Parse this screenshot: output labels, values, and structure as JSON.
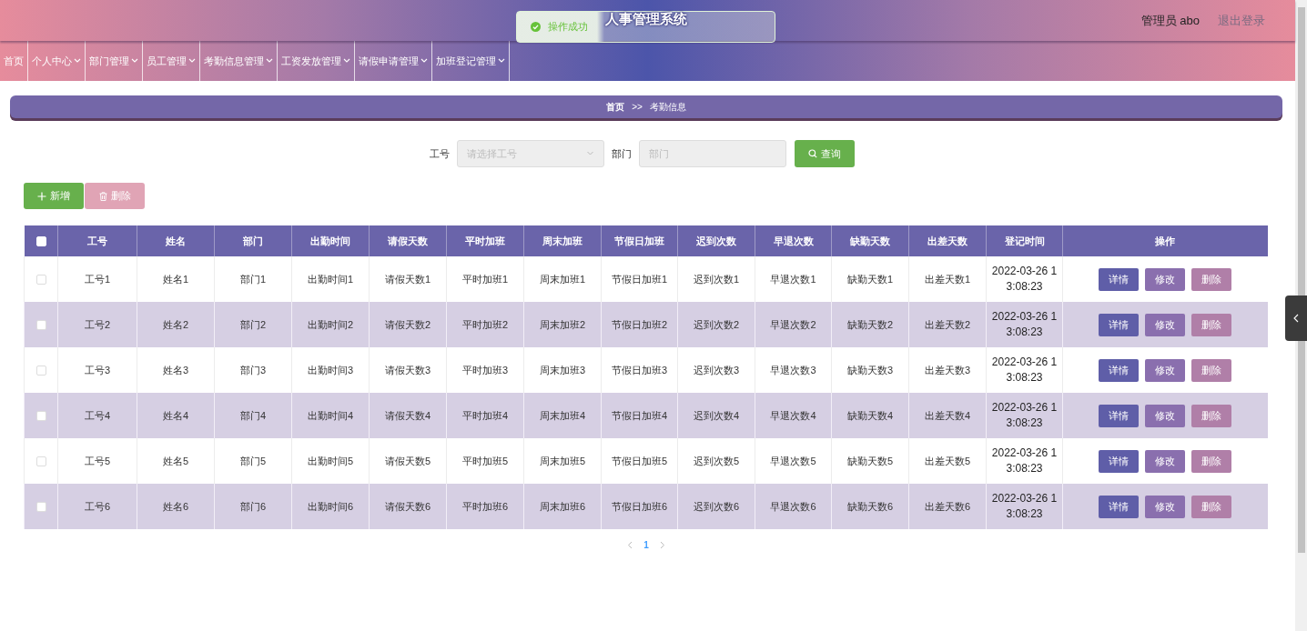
{
  "header": {
    "title": "人事管理系统",
    "user": "管理员 abo",
    "logout": "退出登录"
  },
  "toast": {
    "message": "操作成功"
  },
  "nav": {
    "items": [
      {
        "label": "首页",
        "has_menu": false
      },
      {
        "label": "个人中心",
        "has_menu": true
      },
      {
        "label": "部门管理",
        "has_menu": true
      },
      {
        "label": "员工管理",
        "has_menu": true
      },
      {
        "label": "考勤信息管理",
        "has_menu": true
      },
      {
        "label": "工资发放管理",
        "has_menu": true
      },
      {
        "label": "请假申请管理",
        "has_menu": true
      },
      {
        "label": "加班登记管理",
        "has_menu": true
      }
    ]
  },
  "breadcrumb": {
    "items": [
      "首页",
      "考勤信息"
    ],
    "separator": ">>"
  },
  "search": {
    "fields": [
      {
        "label": "工号",
        "kind": "select",
        "placeholder": "请选择工号"
      },
      {
        "label": "部门",
        "kind": "input",
        "placeholder": "部门"
      }
    ],
    "button": "查询"
  },
  "toolbar": [
    {
      "label": "新增",
      "kind": "add",
      "disabled": false
    },
    {
      "label": "删除",
      "kind": "delete",
      "disabled": true
    }
  ],
  "table": {
    "select_all": {
      "checked": false
    },
    "columns": [
      "工号",
      "姓名",
      "部门",
      "出勤时间",
      "请假天数",
      "平时加班",
      "周末加班",
      "节假日加班",
      "迟到次数",
      "早退次数",
      "缺勤天数",
      "出差天数",
      "登记时间",
      "操作"
    ],
    "rows": [
      {
        "checked": false,
        "cells": [
          "工号1",
          "姓名1",
          "部门1",
          "出勤时间1",
          "请假天数1",
          "平时加班1",
          "周末加班1",
          "节假日加班1",
          "迟到次数1",
          "早退次数1",
          "缺勤天数1",
          "出差天数1",
          "2022-03-26 13:08:23"
        ],
        "actions": [
          {
            "label": "详情",
            "kind": "view"
          },
          {
            "label": "修改",
            "kind": "edit"
          },
          {
            "label": "删除",
            "kind": "delete"
          }
        ]
      },
      {
        "checked": false,
        "cells": [
          "工号2",
          "姓名2",
          "部门2",
          "出勤时间2",
          "请假天数2",
          "平时加班2",
          "周末加班2",
          "节假日加班2",
          "迟到次数2",
          "早退次数2",
          "缺勤天数2",
          "出差天数2",
          "2022-03-26 13:08:23"
        ],
        "actions": [
          {
            "label": "详情",
            "kind": "view"
          },
          {
            "label": "修改",
            "kind": "edit"
          },
          {
            "label": "删除",
            "kind": "delete"
          }
        ]
      },
      {
        "checked": false,
        "cells": [
          "工号3",
          "姓名3",
          "部门3",
          "出勤时间3",
          "请假天数3",
          "平时加班3",
          "周末加班3",
          "节假日加班3",
          "迟到次数3",
          "早退次数3",
          "缺勤天数3",
          "出差天数3",
          "2022-03-26 13:08:23"
        ],
        "actions": [
          {
            "label": "详情",
            "kind": "view"
          },
          {
            "label": "修改",
            "kind": "edit"
          },
          {
            "label": "删除",
            "kind": "delete"
          }
        ]
      },
      {
        "checked": false,
        "cells": [
          "工号4",
          "姓名4",
          "部门4",
          "出勤时间4",
          "请假天数4",
          "平时加班4",
          "周末加班4",
          "节假日加班4",
          "迟到次数4",
          "早退次数4",
          "缺勤天数4",
          "出差天数4",
          "2022-03-26 13:08:23"
        ],
        "actions": [
          {
            "label": "详情",
            "kind": "view"
          },
          {
            "label": "修改",
            "kind": "edit"
          },
          {
            "label": "删除",
            "kind": "delete"
          }
        ]
      },
      {
        "checked": false,
        "cells": [
          "工号5",
          "姓名5",
          "部门5",
          "出勤时间5",
          "请假天数5",
          "平时加班5",
          "周末加班5",
          "节假日加班5",
          "迟到次数5",
          "早退次数5",
          "缺勤天数5",
          "出差天数5",
          "2022-03-26 13:08:23"
        ],
        "actions": [
          {
            "label": "详情",
            "kind": "view"
          },
          {
            "label": "修改",
            "kind": "edit"
          },
          {
            "label": "删除",
            "kind": "delete"
          }
        ]
      },
      {
        "checked": false,
        "cells": [
          "工号6",
          "姓名6",
          "部门6",
          "出勤时间6",
          "请假天数6",
          "平时加班6",
          "周末加班6",
          "节假日加班6",
          "迟到次数6",
          "早退次数6",
          "缺勤天数6",
          "出差天数6",
          "2022-03-26 13:08:23"
        ],
        "actions": [
          {
            "label": "详情",
            "kind": "view"
          },
          {
            "label": "修改",
            "kind": "edit"
          },
          {
            "label": "删除",
            "kind": "delete"
          }
        ]
      }
    ]
  },
  "pagination": {
    "pages": [
      {
        "label": "1",
        "selected": true
      }
    ]
  }
}
